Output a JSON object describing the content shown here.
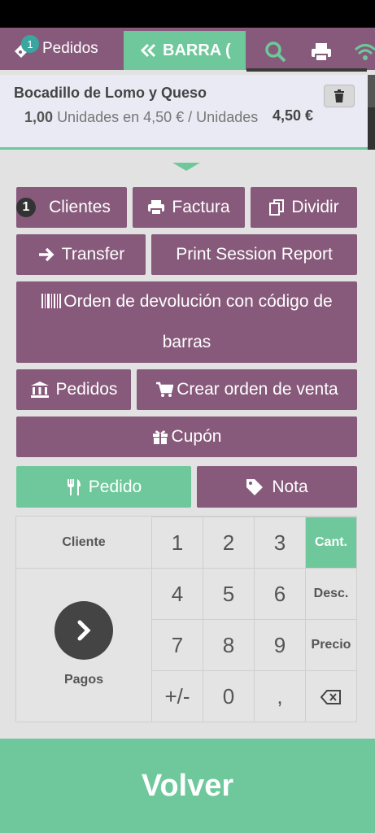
{
  "header": {
    "orders_label": "Pedidos",
    "orders_count": "1",
    "barra_label": "BARRA (",
    "colors": {
      "brand": "#875a7b",
      "accent": "#6ec89b"
    }
  },
  "order_line": {
    "product": "Bocadillo de Lomo y Queso",
    "quantity": "1,00",
    "unit_text": "Unidades en 4,50 € / Unidades",
    "price": "4,50 €"
  },
  "actions": {
    "clientes_count": "1",
    "clientes": "Clientes",
    "factura": "Factura",
    "dividir": "Dividir",
    "transfer": "Transfer",
    "print_session": "Print Session Report",
    "devolucion": "Orden de devolución con código de barras",
    "pedidos": "Pedidos",
    "crear_orden": "Crear orden de venta",
    "cupon": "Cupón",
    "pedido": "Pedido",
    "nota": "Nota"
  },
  "numpad": {
    "cliente": "Cliente",
    "pagos": "Pagos",
    "keys": [
      "1",
      "2",
      "3",
      "4",
      "5",
      "6",
      "7",
      "8",
      "9",
      "+/-",
      "0",
      ","
    ],
    "modes": {
      "qty": "Cant.",
      "disc": "Desc.",
      "price": "Precio"
    },
    "active_mode": "Cant."
  },
  "footer": {
    "volver": "Volver"
  }
}
